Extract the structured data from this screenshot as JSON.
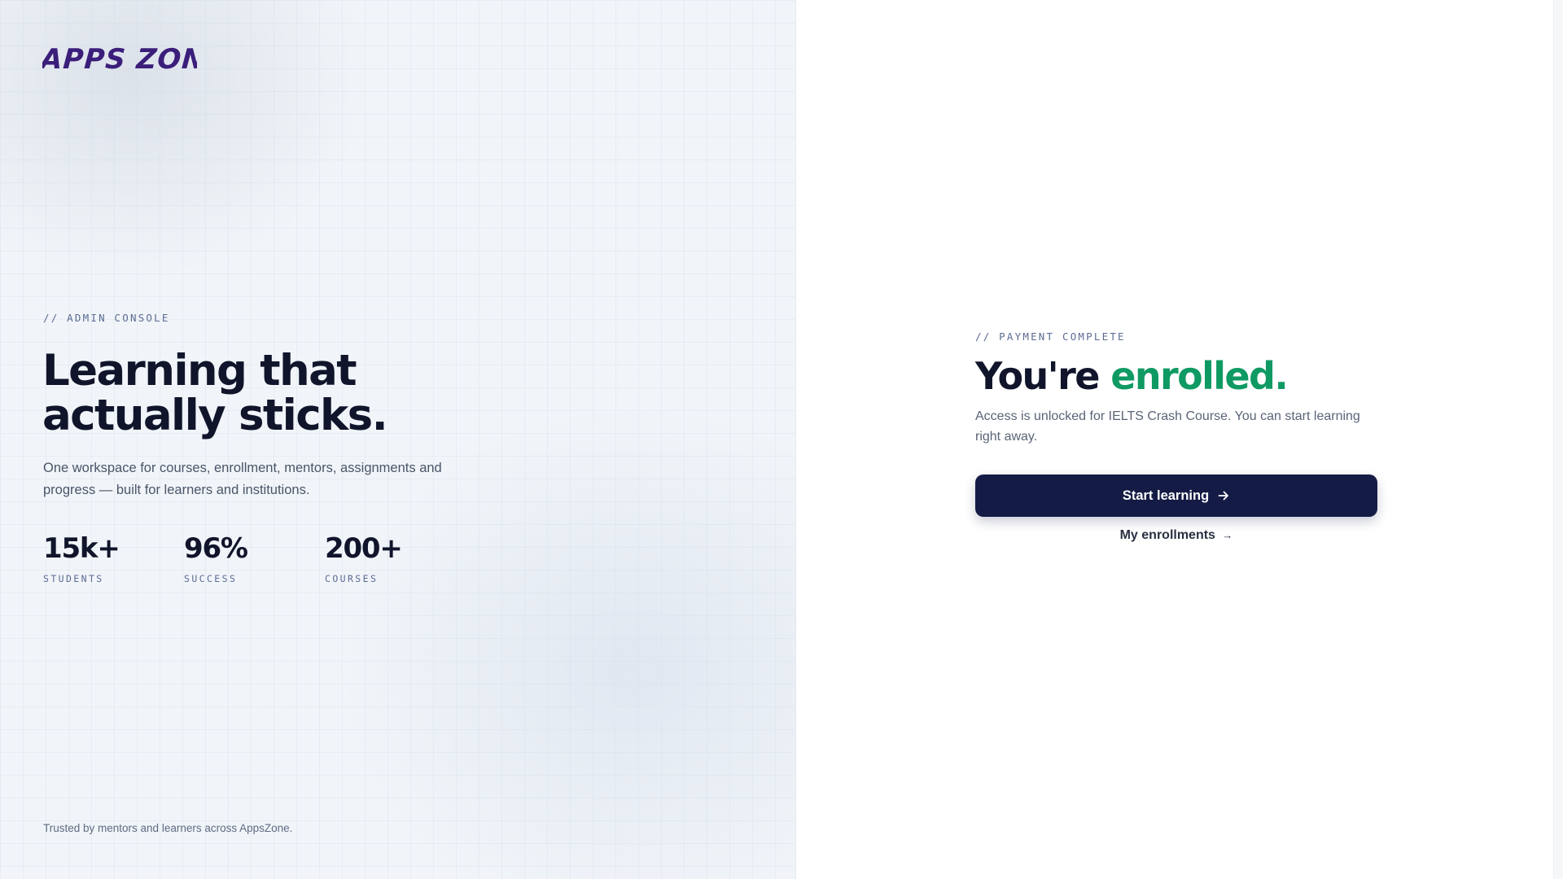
{
  "brand": {
    "logo_text": "APPS ZONE",
    "logo_color": "#3b1e7a"
  },
  "hero": {
    "eyebrow": "// ADMIN CONSOLE",
    "headline_line1": "Learning that",
    "headline_line2": "actually sticks.",
    "subtext": "One workspace for courses, enrollment, mentors, assignments and progress — built for learners and institutions.",
    "stats": [
      {
        "value": "15k+",
        "label": "STUDENTS"
      },
      {
        "value": "96%",
        "label": "SUCCESS"
      },
      {
        "value": "200+",
        "label": "COURSES"
      }
    ],
    "footer": "Trusted by mentors and learners across AppsZone."
  },
  "confirmation": {
    "eyebrow": "// PAYMENT COMPLETE",
    "title_prefix": "You're",
    "title_accent": "enrolled.",
    "accent_color": "#0f9a63",
    "description": "Access is unlocked for IELTS Crash Course. You can start learning right away.",
    "primary_button": {
      "label": "Start learning",
      "icon": "arrow-right-icon"
    },
    "secondary_link": {
      "label": "My enrollments",
      "icon": "→"
    }
  },
  "colors": {
    "primary": "#141b45",
    "left_panel_bg": "#f1f5f9"
  }
}
